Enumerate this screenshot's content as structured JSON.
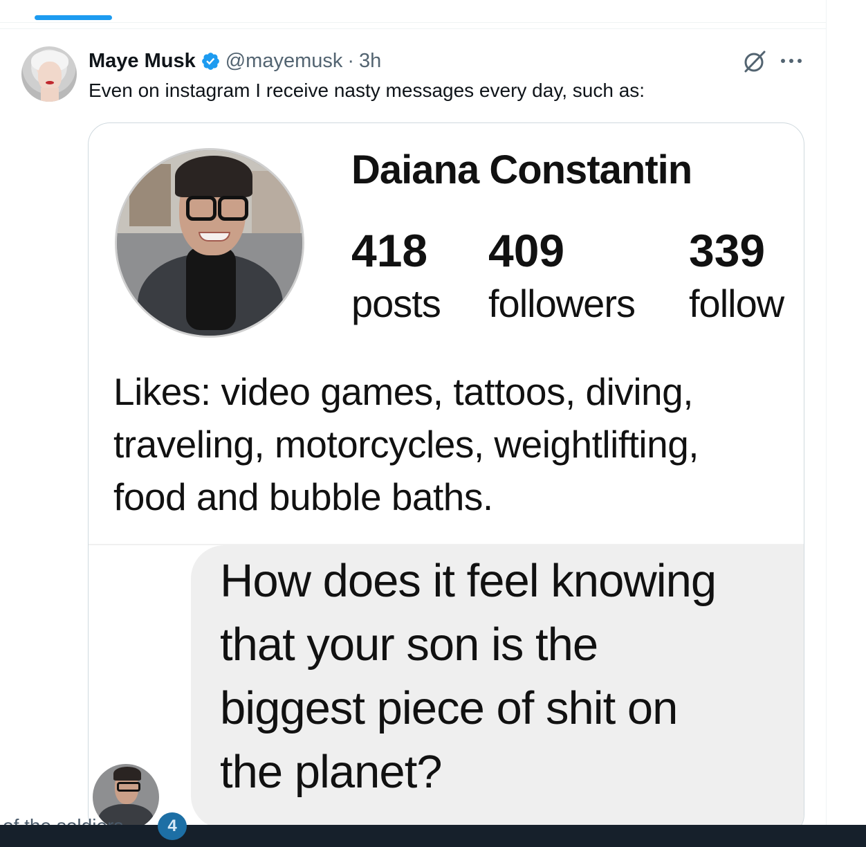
{
  "tweet": {
    "author_name": "Maye Musk",
    "handle": "@mayemusk",
    "separator": "·",
    "time": "3h",
    "text": "Even on instagram I receive nasty messages every day, such as:"
  },
  "embedded_screenshot": {
    "profile_name": "Daiana Constantin",
    "stats": [
      {
        "value": "418",
        "label": "posts"
      },
      {
        "value": "409",
        "label": "followers"
      },
      {
        "value": "339",
        "label": "follow"
      }
    ],
    "bio_lines": [
      "Likes: video games, tattoos, diving,",
      "traveling, motorcycles, weightlifting,",
      "food and bubble baths."
    ],
    "message_lines": [
      "How does it feel knowing",
      "that your son is the",
      "biggest piece of shit on",
      "the planet?"
    ]
  },
  "bottom_strip": {
    "text": "of the soldiers...",
    "badge": "4"
  },
  "colors": {
    "accent": "#1d9bf0",
    "secondary_text": "#536471",
    "border": "#cfd9de",
    "bubble": "#efefef"
  },
  "icons": [
    "verified-badge-icon",
    "grok-icon",
    "more-icon"
  ]
}
